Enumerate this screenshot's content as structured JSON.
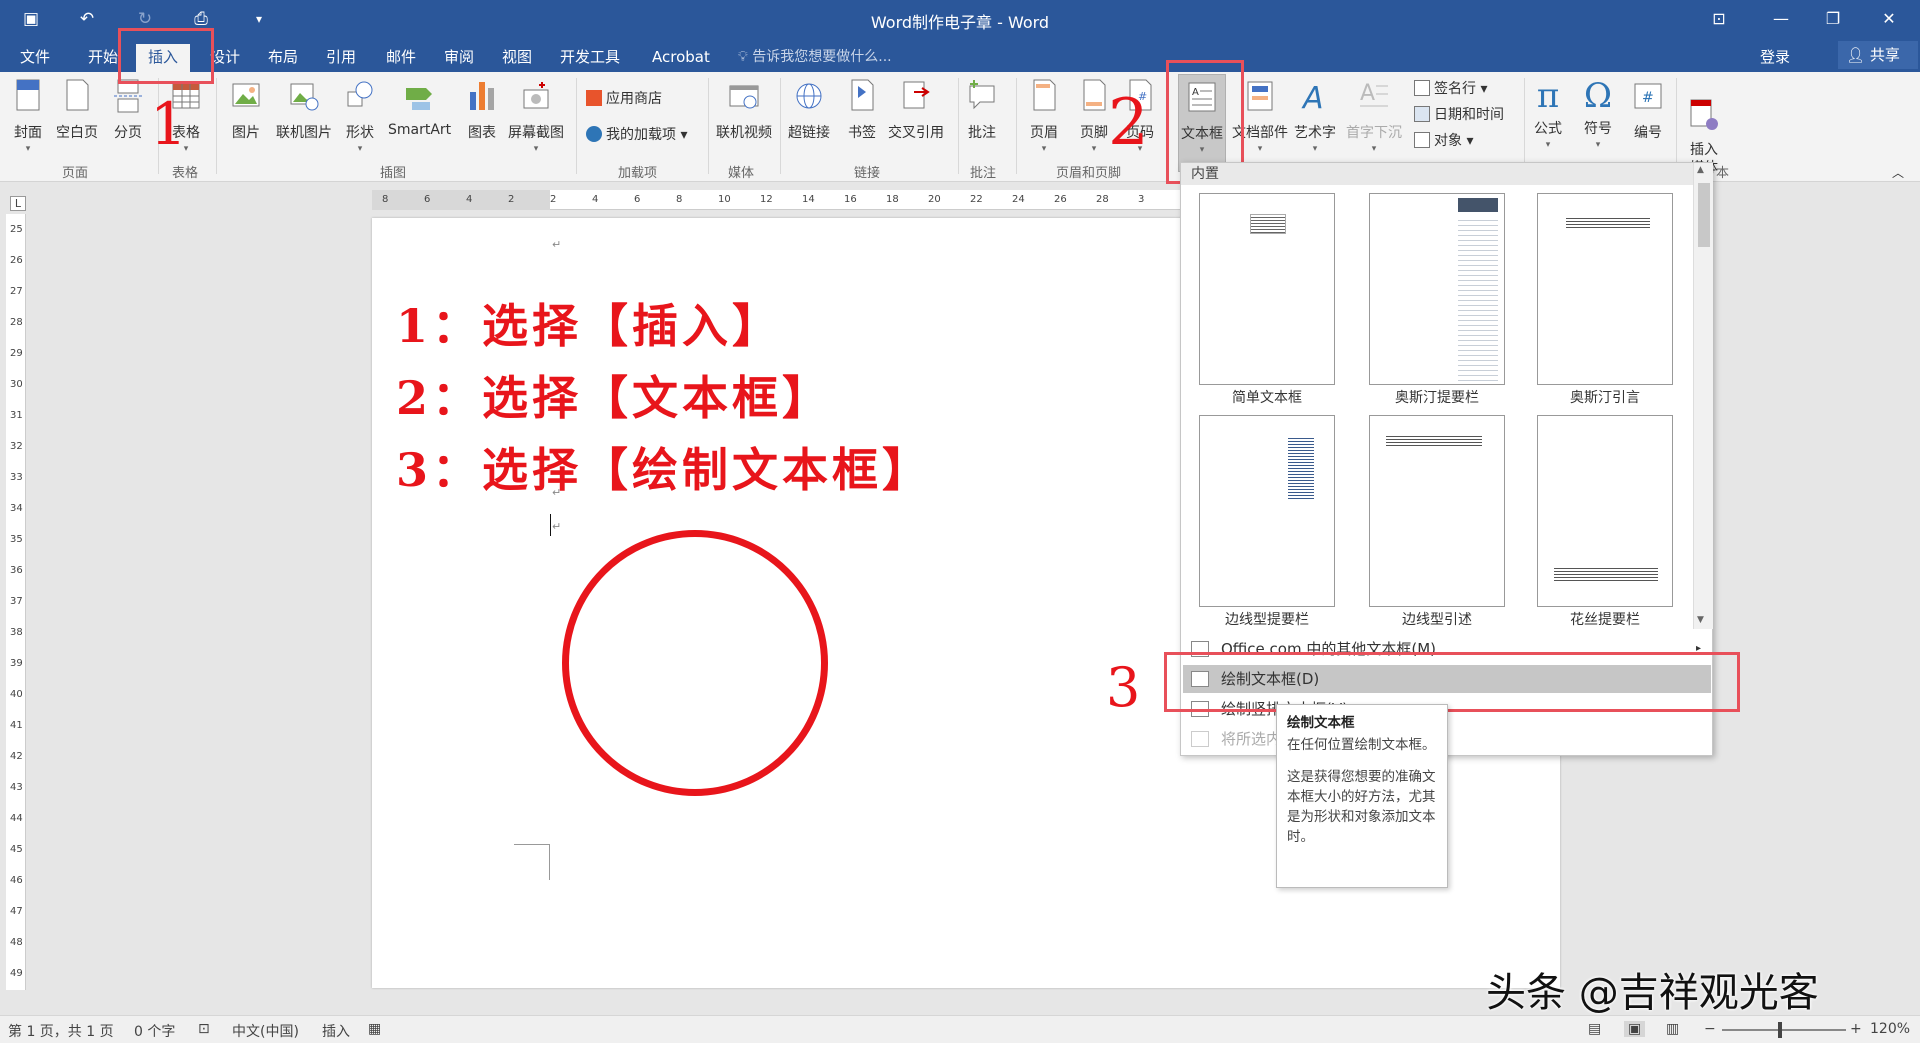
{
  "window": {
    "title": "Word制作电子章 - Word"
  },
  "tabs": [
    {
      "id": "file",
      "label": "文件"
    },
    {
      "id": "home",
      "label": "开始"
    },
    {
      "id": "insert",
      "label": "插入"
    },
    {
      "id": "design",
      "label": "设计"
    },
    {
      "id": "layout",
      "label": "布局"
    },
    {
      "id": "references",
      "label": "引用"
    },
    {
      "id": "mailings",
      "label": "邮件"
    },
    {
      "id": "review",
      "label": "审阅"
    },
    {
      "id": "view",
      "label": "视图"
    },
    {
      "id": "developer",
      "label": "开发工具"
    },
    {
      "id": "acrobat",
      "label": "Acrobat"
    }
  ],
  "tell_me": "告诉我您想要做什么...",
  "account": {
    "login": "登录",
    "share": "共享"
  },
  "ribbon": {
    "cover": "封面",
    "blank": "空白页",
    "pagebreak": "分页",
    "table": "表格",
    "picture": "图片",
    "online_picture": "联机图片",
    "shapes": "形状",
    "smartart": "SmartArt",
    "chart": "图表",
    "screenshot": "屏幕截图",
    "store": "应用商店",
    "myaddins": "我的加载项",
    "online_video": "联机视频",
    "hyperlink": "超链接",
    "bookmark": "书签",
    "crossref": "交叉引用",
    "comment": "批注",
    "header": "页眉",
    "footer": "页脚",
    "pagenum": "页码",
    "textbox": "文本框",
    "quickparts": "文档部件",
    "wordart": "艺术字",
    "dropcap": "首字下沉",
    "signature": "签名行",
    "datetime": "日期和时间",
    "object": "对象",
    "equation": "公式",
    "symbol": "符号",
    "number": "编号",
    "insert_media": "插入\n媒体",
    "groups": {
      "pages": "页面",
      "tables": "表格",
      "illustrations": "插图",
      "addins": "加载项",
      "media": "媒体",
      "links": "链接",
      "comments": "批注",
      "headerfooter": "页眉和页脚",
      "text_partial": "本"
    }
  },
  "ruler_numbers_h": [
    "8",
    "6",
    "4",
    "2",
    "2",
    "4",
    "6",
    "8",
    "10",
    "12",
    "14",
    "16",
    "18",
    "20",
    "22",
    "24",
    "26",
    "28",
    "3"
  ],
  "ruler_numbers_v": [
    "25",
    "26",
    "27",
    "28",
    "29",
    "30",
    "31",
    "32",
    "33",
    "34",
    "35",
    "36",
    "37",
    "38",
    "39",
    "40",
    "41",
    "42",
    "43",
    "44",
    "45",
    "46",
    "47",
    "48",
    "49"
  ],
  "document": {
    "steps": [
      "1：选择【插入】",
      "2：选择【文本框】",
      "3：选择【绘制文本框】"
    ],
    "paragraph_mark": "↵"
  },
  "annotations": {
    "a1": "1",
    "a2": "2",
    "a3": "3"
  },
  "gallery": {
    "header": "内置",
    "items": [
      "简单文本框",
      "奥斯汀提要栏",
      "奥斯汀引言",
      "边线型提要栏",
      "边线型引述",
      "花丝提要栏"
    ],
    "menu": {
      "more": "Office.com 中的其他文本框(M)",
      "draw": "绘制文本框(D)",
      "draw_vertical": "绘制竖排文本框(V)",
      "save_selection": "将所选内容保存到文本框库(S)"
    }
  },
  "tooltip": {
    "title": "绘制文本框",
    "line1": "在任何位置绘制文本框。",
    "line2": "这是获得您想要的准确文本框大小的好方法，尤其是为形状和对象添加文本时。"
  },
  "status": {
    "page": "第 1 页，共 1 页",
    "words": "0 个字",
    "language": "中文(中国)",
    "mode": "插入",
    "zoom": "120%"
  },
  "watermark": "头条 @吉祥观光客",
  "colors": {
    "brand": "#2b579a",
    "stamp_red": "#e8151b",
    "annotation_box": "#e8505a"
  }
}
